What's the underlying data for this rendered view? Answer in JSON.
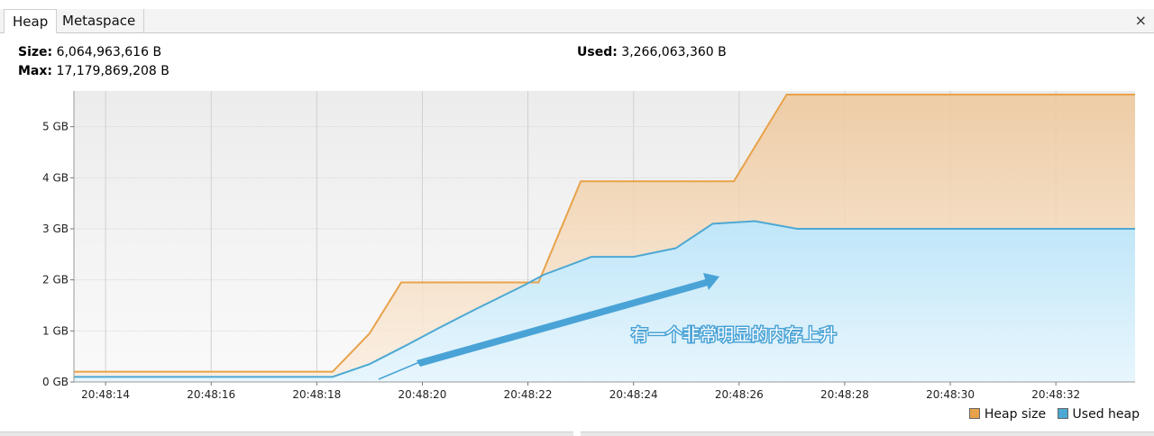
{
  "tabs": [
    {
      "label": "Heap",
      "active": true
    },
    {
      "label": "Metaspace",
      "active": false
    }
  ],
  "close_glyph": "×",
  "stats": {
    "size_label": "Size:",
    "size_value": "6,064,963,616 B",
    "max_label": "Max:",
    "max_value": "17,179,869,208 B",
    "used_label": "Used:",
    "used_value": "3,266,063,360 B"
  },
  "annotation": "有一个非常明显的内存上升",
  "colors": {
    "heap_fill": "#f3d4aa",
    "heap_line": "#e8a24a",
    "used_fill": "#c6e9f7",
    "used_line": "#4da8d3",
    "arrow": "#4aa3d6",
    "plot_bg": "#f3f3f3"
  },
  "chart_data": {
    "type": "area",
    "y_unit": "GB",
    "ylim": [
      0,
      5.7
    ],
    "xlim": [
      "20:48:13.4",
      "20:48:33.5"
    ],
    "yticks": [
      {
        "v": 0,
        "label": "0 GB"
      },
      {
        "v": 1,
        "label": "1 GB"
      },
      {
        "v": 2,
        "label": "2 GB"
      },
      {
        "v": 3,
        "label": "3 GB"
      },
      {
        "v": 4,
        "label": "4 GB"
      },
      {
        "v": 5,
        "label": "5 GB"
      }
    ],
    "xticks": [
      {
        "t": "20:48:14",
        "label": "20:48:14"
      },
      {
        "t": "20:48:16",
        "label": "20:48:16"
      },
      {
        "t": "20:48:18",
        "label": "20:48:18"
      },
      {
        "t": "20:48:20",
        "label": "20:48:20"
      },
      {
        "t": "20:48:22",
        "label": "20:48:22"
      },
      {
        "t": "20:48:24",
        "label": "20:48:24"
      },
      {
        "t": "20:48:26",
        "label": "20:48:26"
      },
      {
        "t": "20:48:28",
        "label": "20:48:28"
      },
      {
        "t": "20:48:30",
        "label": "20:48:30"
      },
      {
        "t": "20:48:32",
        "label": "20:48:32"
      }
    ],
    "series": [
      {
        "name": "Heap size",
        "points": [
          [
            "20:48:13.4",
            0.2
          ],
          [
            "20:48:18.3",
            0.2
          ],
          [
            "20:48:19.0",
            0.95
          ],
          [
            "20:48:19.6",
            1.95
          ],
          [
            "20:48:22.2",
            1.95
          ],
          [
            "20:48:23.0",
            3.93
          ],
          [
            "20:48:25.9",
            3.93
          ],
          [
            "20:48:26.9",
            5.63
          ],
          [
            "20:48:33.5",
            5.63
          ]
        ]
      },
      {
        "name": "Used heap",
        "points": [
          [
            "20:48:13.4",
            0.1
          ],
          [
            "20:48:18.3",
            0.1
          ],
          [
            "20:48:19.0",
            0.35
          ],
          [
            "20:48:19.7",
            0.72
          ],
          [
            "20:48:20.3",
            1.05
          ],
          [
            "20:48:21.0",
            1.42
          ],
          [
            "20:48:21.9",
            1.88
          ],
          [
            "20:48:22.3",
            2.1
          ],
          [
            "20:48:23.2",
            2.45
          ],
          [
            "20:48:24.0",
            2.45
          ],
          [
            "20:48:24.8",
            2.62
          ],
          [
            "20:48:25.5",
            3.1
          ],
          [
            "20:48:26.3",
            3.15
          ],
          [
            "20:48:27.1",
            3.0
          ],
          [
            "20:48:33.5",
            3.0
          ]
        ]
      }
    ],
    "legend": [
      {
        "name": "Heap size",
        "color": "#e8a24a"
      },
      {
        "name": "Used heap",
        "color": "#4da8d3"
      }
    ],
    "legend_position": "bottom-right"
  }
}
